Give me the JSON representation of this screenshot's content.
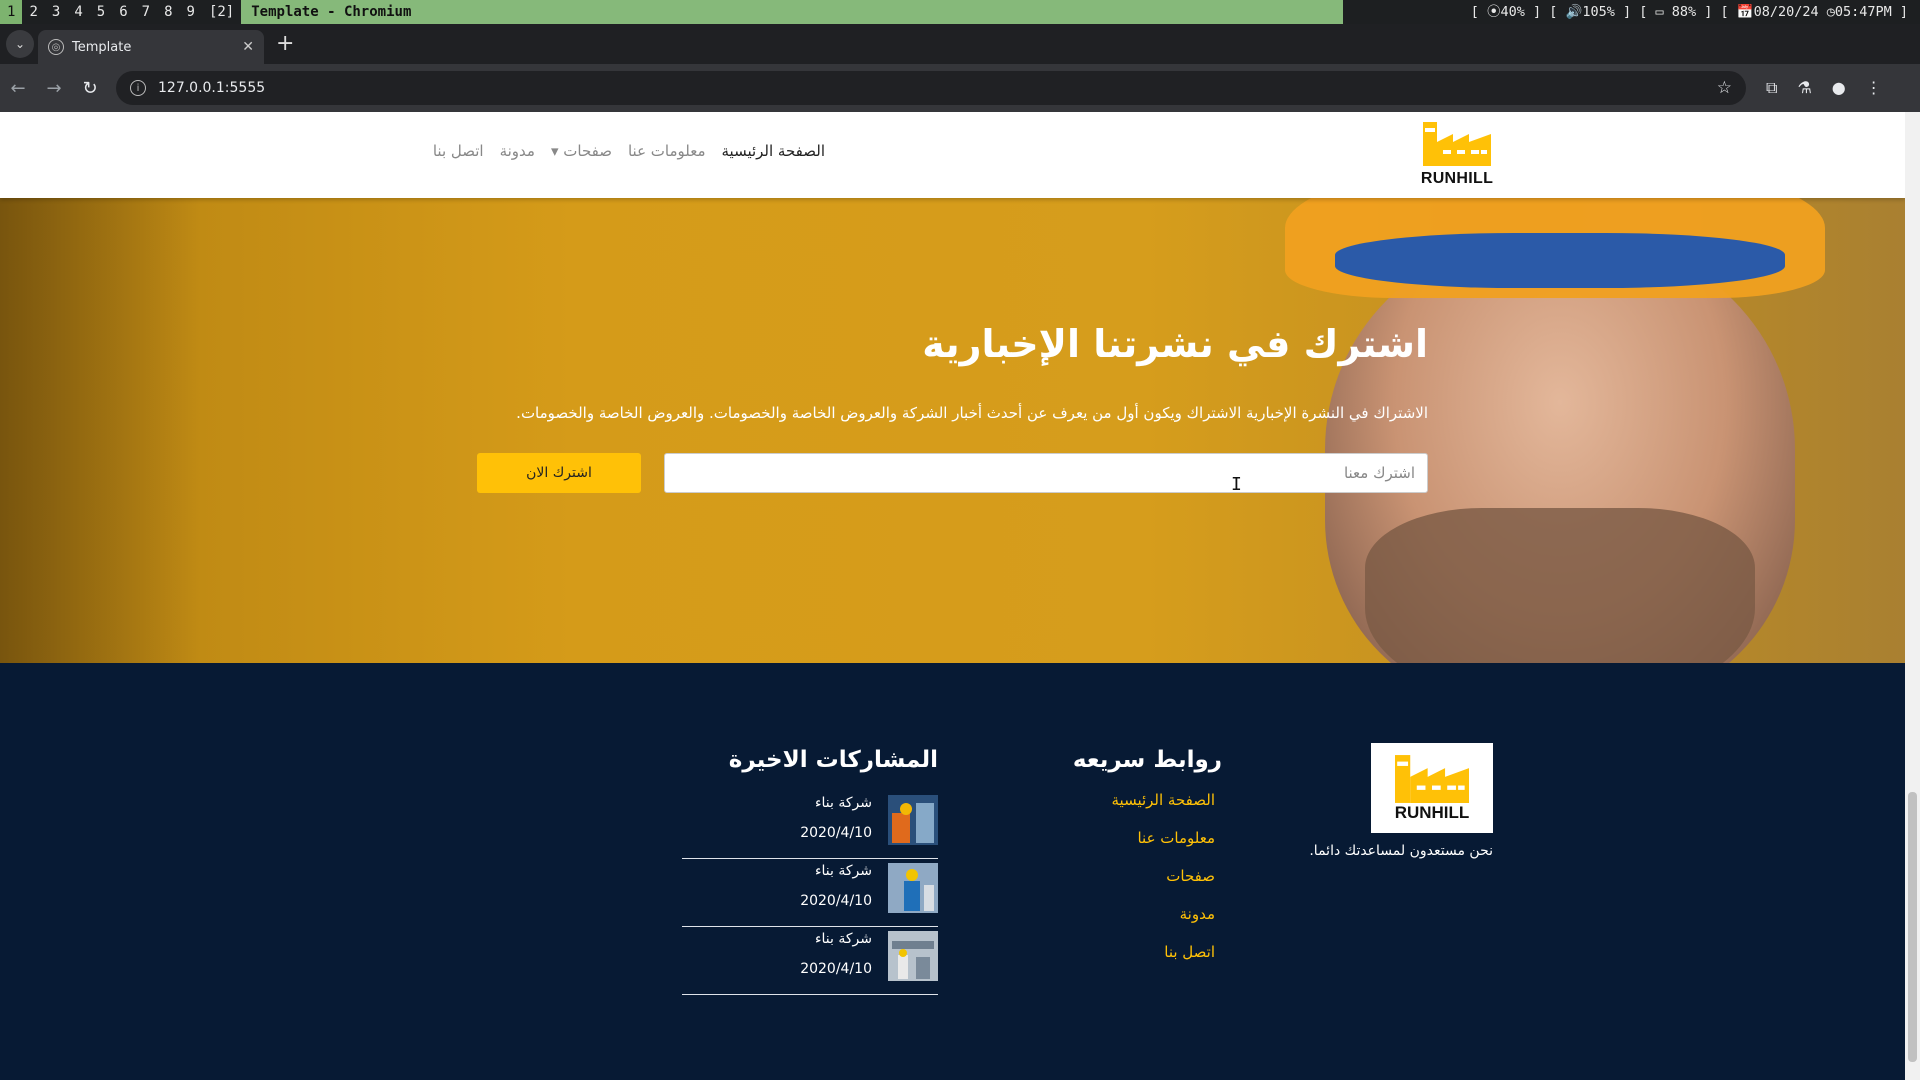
{
  "i3": {
    "workspaces": [
      "1",
      "2",
      "3",
      "4",
      "5",
      "6",
      "7",
      "8",
      "9",
      "[2]"
    ],
    "window_title": "Template - Chromium",
    "status": "[ ⦿40% ] [ 🔊105% ] [ ▭ 88% ] [ 📅08/20/24 ◷05:47PM ]"
  },
  "browser": {
    "tab_title": "Template",
    "url": "127.0.0.1:5555"
  },
  "site": {
    "brand": "RUNHILL",
    "menu": [
      {
        "label": "الصفحة الرئيسية"
      },
      {
        "label": "معلومات عنا"
      },
      {
        "label": "صفحات ▾"
      },
      {
        "label": "مدونة"
      },
      {
        "label": "اتصل بنا"
      }
    ]
  },
  "hero": {
    "title": "اشترك في نشرتنا الإخبارية",
    "description": "الاشتراك في النشرة الإخبارية الاشتراك ويكون أول من يعرف عن أحدث أخبار الشركة والعروض الخاصة والخصومات. والعروض الخاصة والخصومات.",
    "input_placeholder": "اشترك معنا",
    "button_label": "اشترك الان"
  },
  "footer": {
    "brand": "RUNHILL",
    "about": "نحن مستعدون لمساعدتك دائما.",
    "links_title": "روابط سريعه",
    "links": [
      "الصفحة الرئيسية",
      "معلومات عنا",
      "صفحات",
      "مدونة",
      "اتصل بنا"
    ],
    "posts_title": "المشاركات الاخيرة",
    "posts": [
      {
        "title": "شركة بناء",
        "date": "2020/4/10"
      },
      {
        "title": "شركة بناء",
        "date": "2020/4/10"
      },
      {
        "title": "شركة بناء",
        "date": "2020/4/10"
      }
    ]
  },
  "colors": {
    "accent": "#ffc107",
    "footer_bg": "#071a34",
    "hero_bg": "#d59b19"
  }
}
